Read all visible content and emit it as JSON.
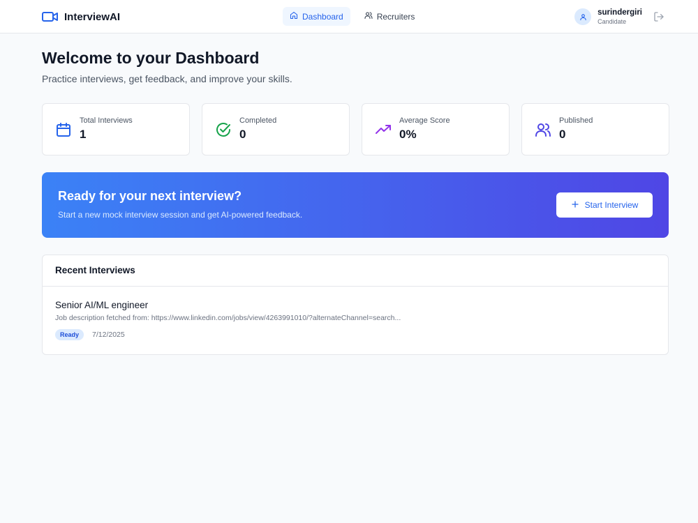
{
  "header": {
    "brand": "InterviewAI",
    "nav": [
      {
        "label": "Dashboard",
        "active": true
      },
      {
        "label": "Recruiters",
        "active": false
      }
    ],
    "user": {
      "name": "surindergiri",
      "role": "Candidate"
    }
  },
  "page": {
    "title": "Welcome to your Dashboard",
    "subtitle": "Practice interviews, get feedback, and improve your skills."
  },
  "stats": [
    {
      "label": "Total Interviews",
      "value": "1",
      "icon": "calendar-icon",
      "color": "#2563eb"
    },
    {
      "label": "Completed",
      "value": "0",
      "icon": "check-circle-icon",
      "color": "#16a34a"
    },
    {
      "label": "Average Score",
      "value": "0%",
      "icon": "trending-up-icon",
      "color": "#9333ea"
    },
    {
      "label": "Published",
      "value": "0",
      "icon": "users-icon",
      "color": "#4f46e5"
    }
  ],
  "banner": {
    "title": "Ready for your next interview?",
    "subtitle": "Start a new mock interview session and get AI-powered feedback.",
    "button": "Start Interview"
  },
  "recent": {
    "heading": "Recent Interviews",
    "items": [
      {
        "title": "Senior AI/ML engineer",
        "description": "Job description fetched from: https://www.linkedin.com/jobs/view/4263991010/?alternateChannel=search...",
        "status": "Ready",
        "date": "7/12/2025"
      }
    ]
  },
  "colors": {
    "accent": "#2563eb",
    "background": "#f8fafc",
    "banner_start": "#3b82f6",
    "banner_end": "#4f46e5"
  }
}
